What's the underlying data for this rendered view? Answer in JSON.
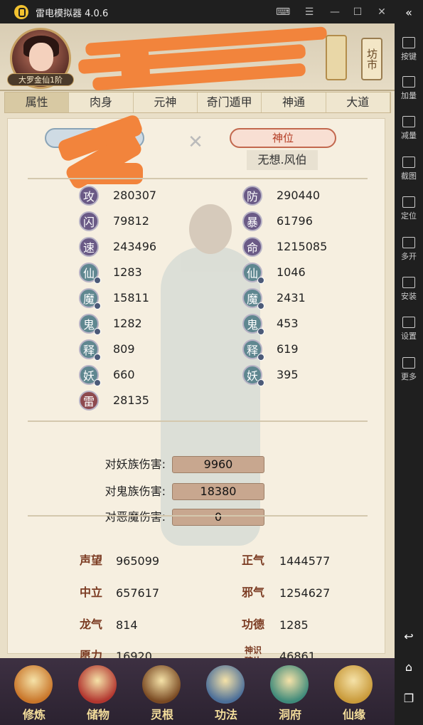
{
  "window": {
    "title": "雷电模拟器 4.0.6"
  },
  "sidebar": {
    "items": [
      {
        "label": "按键",
        "icon": "keyboard-icon"
      },
      {
        "label": "加量",
        "icon": "volume-up-icon"
      },
      {
        "label": "减量",
        "icon": "volume-down-icon"
      },
      {
        "label": "截图",
        "icon": "screenshot-icon"
      },
      {
        "label": "定位",
        "icon": "location-icon"
      },
      {
        "label": "多开",
        "icon": "multi-instance-icon"
      },
      {
        "label": "安装",
        "icon": "install-icon"
      },
      {
        "label": "设置",
        "icon": "settings-icon"
      },
      {
        "label": "更多",
        "icon": "more-icon"
      }
    ]
  },
  "game": {
    "rank_badge": "大罗金仙1阶",
    "market_label": "坊市",
    "tabs": [
      "属性",
      "肉身",
      "元神",
      "奇门遁甲",
      "神通",
      "大道"
    ],
    "active_tab": 0,
    "position": {
      "label": "神位",
      "value": "无想.风伯"
    },
    "stats_left": [
      {
        "icon": "攻",
        "value": "280307",
        "style": "purple",
        "info": false
      },
      {
        "icon": "闪",
        "value": "79812",
        "style": "purple",
        "info": false
      },
      {
        "icon": "速",
        "value": "243496",
        "style": "purple",
        "info": false
      },
      {
        "icon": "仙",
        "value": "1283",
        "style": "teal",
        "info": true
      },
      {
        "icon": "魔",
        "value": "15811",
        "style": "teal",
        "info": true
      },
      {
        "icon": "鬼",
        "value": "1282",
        "style": "teal",
        "info": true
      },
      {
        "icon": "释",
        "value": "809",
        "style": "teal",
        "info": true
      },
      {
        "icon": "妖",
        "value": "660",
        "style": "teal",
        "info": true
      },
      {
        "icon": "雷",
        "value": "28135",
        "style": "red",
        "info": false
      }
    ],
    "stats_right": [
      {
        "icon": "防",
        "value": "290440",
        "style": "purple",
        "info": false
      },
      {
        "icon": "暴",
        "value": "61796",
        "style": "purple",
        "info": false
      },
      {
        "icon": "命",
        "value": "1215085",
        "style": "purple",
        "info": false
      },
      {
        "icon": "仙",
        "value": "1046",
        "style": "teal",
        "info": true
      },
      {
        "icon": "魔",
        "value": "2431",
        "style": "teal",
        "info": true
      },
      {
        "icon": "鬼",
        "value": "453",
        "style": "teal",
        "info": true
      },
      {
        "icon": "释",
        "value": "619",
        "style": "teal",
        "info": true
      },
      {
        "icon": "妖",
        "value": "395",
        "style": "teal",
        "info": true
      }
    ],
    "damage": [
      {
        "label": "对妖族伤害:",
        "value": "9960"
      },
      {
        "label": "对鬼族伤害:",
        "value": "18380"
      },
      {
        "label": "对恶魔伤害:",
        "value": "0"
      }
    ],
    "reputation_left": [
      {
        "label": "声望",
        "value": "965099"
      },
      {
        "label": "中立",
        "value": "657617"
      },
      {
        "label": "龙气",
        "value": "814"
      },
      {
        "label": "愿力",
        "value": "16920"
      }
    ],
    "reputation_right": [
      {
        "label": "正气",
        "value": "1444577"
      },
      {
        "label": "邪气",
        "value": "1254627"
      },
      {
        "label": "功德",
        "value": "1285"
      },
      {
        "label": "神识碎片",
        "value": "46861"
      }
    ],
    "bottom_nav": [
      {
        "label": "修炼",
        "icon": "cultivate-icon",
        "color": "#c9762a"
      },
      {
        "label": "储物",
        "icon": "storage-bag-icon",
        "color": "#b2362f"
      },
      {
        "label": "灵根",
        "icon": "spirit-root-icon",
        "color": "#7a4a23"
      },
      {
        "label": "功法",
        "icon": "technique-book-icon",
        "color": "#4c6f99"
      },
      {
        "label": "洞府",
        "icon": "cave-dwelling-icon",
        "color": "#3f8a7a"
      },
      {
        "label": "仙缘",
        "icon": "fate-gourd-icon",
        "color": "#c99a3a"
      }
    ]
  }
}
